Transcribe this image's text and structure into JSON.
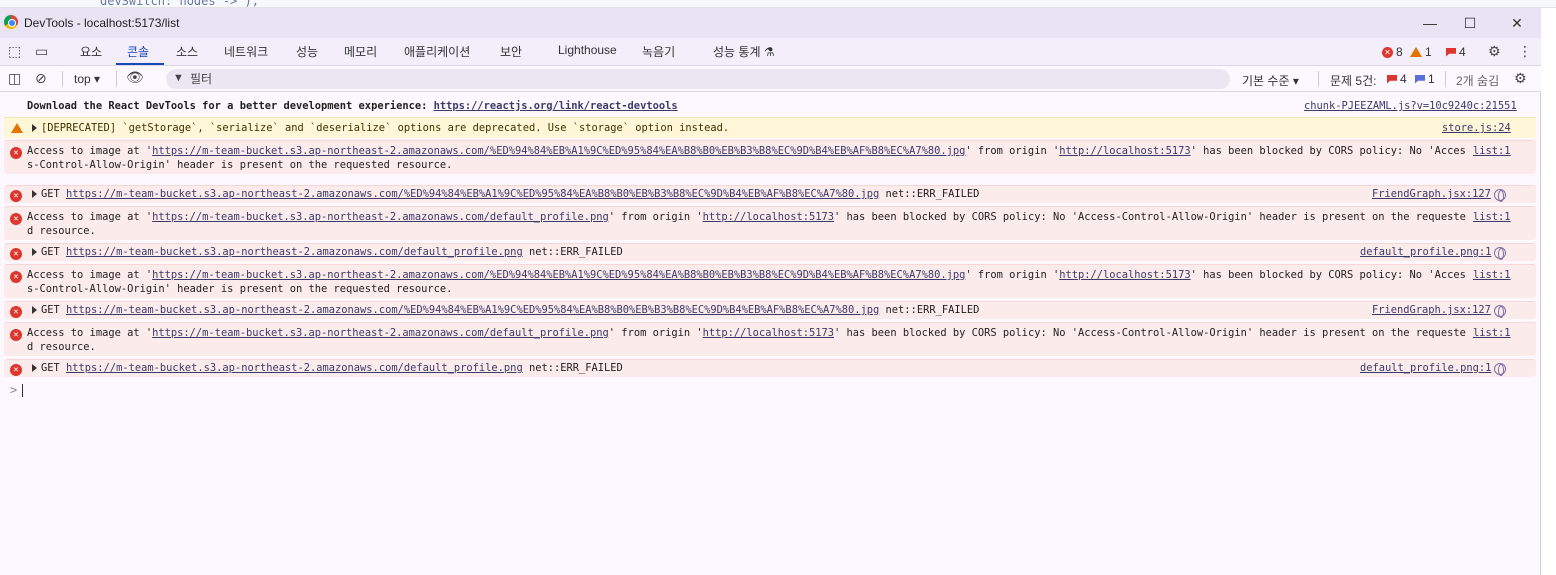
{
  "background_code": "devSwitch: nodes -> );",
  "window": {
    "title": "DevTools - localhost:5173/list"
  },
  "window_controls": {
    "minimize": "—",
    "maximize": "☐",
    "close": "✕"
  },
  "tabs": [
    "요소",
    "콘솔",
    "소스",
    "네트워크",
    "성능",
    "메모리",
    "애플리케이션",
    "보안",
    "Lighthouse",
    "녹음기",
    "성능 통계 ⚗"
  ],
  "active_tab": "콘솔",
  "counts": {
    "errors": "8",
    "warnings": "1",
    "issues": "4"
  },
  "toolbar": {
    "context": "top ▾",
    "filter_placeholder": "필터",
    "levels": "기본 수준 ▾",
    "issues_label": "문제 5건:",
    "issues_errors": "4",
    "issues_info": "1",
    "hidden": "2개 숨김"
  },
  "messages": [
    {
      "type": "info",
      "text": "Download the React DevTools for a better development experience: ",
      "link": "https://reactjs.org/link/react-devtools",
      "source": "chunk-PJEEZAML.js?v=10c9240c:21551"
    },
    {
      "type": "warn",
      "text": "[DEPRECATED] `getStorage`, `serialize` and `deserialize` options are deprecated. Use `storage` option instead.",
      "source": "store.js:24"
    },
    {
      "type": "err",
      "pre": "Access to image at '",
      "link": "https://m-team-bucket.s3.ap-northeast-2.amazonaws.com/%ED%94%84%EB%A1%9C%ED%95%84%EA%B8%B0%EB%B3%B8%EC%9D%B4%EB%AF%B8%EC%A7%80.jpg",
      "mid": "' from origin '",
      "origin": "http://localhost:5173",
      "post": "' has been blocked by CORS policy: No 'Access-Control-Allow-Origin' header is present on the requested resource.",
      "source": "list:1"
    },
    {
      "type": "err",
      "pre": "GET ",
      "link": "https://m-team-bucket.s3.ap-northeast-2.amazonaws.com/%ED%94%84%EB%A1%9C%ED%95%84%EA%B8%B0%EB%B3%B8%EC%9D%B4%EB%AF%B8%EC%A7%80.jpg",
      "post": " net::ERR_FAILED",
      "source": "FriendGraph.jsx:127"
    },
    {
      "type": "err",
      "pre": "Access to image at '",
      "link": "https://m-team-bucket.s3.ap-northeast-2.amazonaws.com/default_profile.png",
      "mid": "' from origin '",
      "origin": "http://localhost:5173",
      "post": "' has been blocked by CORS policy: No 'Access-Control-Allow-Origin' header is present on the requested resource.",
      "source": "list:1"
    },
    {
      "type": "err",
      "pre": "GET ",
      "link": "https://m-team-bucket.s3.ap-northeast-2.amazonaws.com/default_profile.png",
      "post": " net::ERR_FAILED",
      "source": "default_profile.png:1"
    },
    {
      "type": "err",
      "pre": "Access to image at '",
      "link": "https://m-team-bucket.s3.ap-northeast-2.amazonaws.com/%ED%94%84%EB%A1%9C%ED%95%84%EA%B8%B0%EB%B3%B8%EC%9D%B4%EB%AF%B8%EC%A7%80.jpg",
      "mid": "' from origin '",
      "origin": "http://localhost:5173",
      "post": "' has been blocked by CORS policy: No 'Access-Control-Allow-Origin' header is present on the requested resource.",
      "source": "list:1"
    },
    {
      "type": "err",
      "pre": "GET ",
      "link": "https://m-team-bucket.s3.ap-northeast-2.amazonaws.com/%ED%94%84%EB%A1%9C%ED%95%84%EA%B8%B0%EB%B3%B8%EC%9D%B4%EB%AF%B8%EC%A7%80.jpg",
      "post": " net::ERR_FAILED",
      "source": "FriendGraph.jsx:127"
    },
    {
      "type": "err",
      "pre": "Access to image at '",
      "link": "https://m-team-bucket.s3.ap-northeast-2.amazonaws.com/default_profile.png",
      "mid": "' from origin '",
      "origin": "http://localhost:5173",
      "post": "' has been blocked by CORS policy: No 'Access-Control-Allow-Origin' header is present on the requested resource.",
      "source": "list:1"
    },
    {
      "type": "err",
      "pre": "GET ",
      "link": "https://m-team-bucket.s3.ap-northeast-2.amazonaws.com/default_profile.png",
      "post": " net::ERR_FAILED",
      "source": "default_profile.png:1"
    }
  ],
  "prompt_symbol": ">"
}
